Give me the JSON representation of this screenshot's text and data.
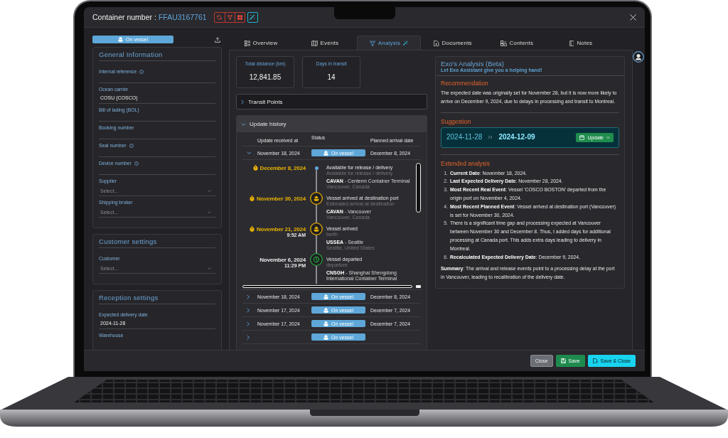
{
  "window": {
    "title": "Container number :",
    "container_number": "FFAU3167761"
  },
  "status_badge": {
    "label": "On vessel"
  },
  "sections": [
    {
      "title": "General Information",
      "fields": [
        {
          "kind": "text",
          "label": "Internal reference",
          "info": true
        },
        {
          "kind": "text",
          "label": "Ocean carrier",
          "info": false,
          "value": "COSU (COSCO)"
        },
        {
          "kind": "text",
          "label": "Bill of lading (BOL)",
          "info": false
        },
        {
          "kind": "text",
          "label": "Booking number",
          "info": false
        },
        {
          "kind": "text",
          "label": "Seal number",
          "info": true
        },
        {
          "kind": "text",
          "label": "Device number",
          "info": true
        },
        {
          "kind": "select",
          "label": "Supplier",
          "info": false,
          "placeholder": "Select..."
        },
        {
          "kind": "select",
          "label": "Shipping broker",
          "info": false,
          "placeholder": "Select..."
        }
      ]
    },
    {
      "title": "Customer settings",
      "fields": [
        {
          "kind": "select",
          "label": "Customer",
          "info": false,
          "placeholder": "Select..."
        }
      ]
    },
    {
      "title": "Reception settings",
      "fields": [
        {
          "kind": "text",
          "label": "Expected delivery date",
          "info": false,
          "value": "2024-11-28"
        },
        {
          "kind": "label",
          "label": "Warehouse",
          "info": false
        }
      ]
    }
  ],
  "tabs": [
    {
      "label": "Overview",
      "selected": false
    },
    {
      "label": "Events",
      "selected": false
    },
    {
      "label": "Analysis",
      "selected": true
    },
    {
      "label": "Documents",
      "selected": false
    },
    {
      "label": "Contents",
      "selected": false
    },
    {
      "label": "Notes",
      "selected": false
    }
  ],
  "stats": [
    {
      "label": "Total distance (km)",
      "value": "12,841.85"
    },
    {
      "label": "Days in transit",
      "value": "14"
    }
  ],
  "transit_points": {
    "title": "Transit Points",
    "expanded": false
  },
  "update_history": {
    "title": "Update history",
    "expanded": true,
    "columns": [
      "Update received at",
      "Status",
      "Planned arrival date"
    ],
    "rows": [
      {
        "expanded": true,
        "received": "November 18, 2024",
        "status": "On vessel",
        "planned": "December 8, 2024",
        "events": [
          {
            "kind": "release",
            "planned": true,
            "date": "December 8, 2024",
            "title": "Available for release / delivery",
            "detail": "Available for release / delivery",
            "location": "**CAVAN** - Centerm Container Terminal",
            "place": "Vancouver, Canada"
          },
          {
            "kind": "arrival",
            "planned": true,
            "date": "November 30, 2024",
            "title": "Vessel arrived at destination port",
            "detail": "Estimated arrival at destination",
            "location": "**CAVAN** - Vancouver",
            "place": "Vancouver, Canada"
          },
          {
            "kind": "arrival",
            "planned": true,
            "date": "November 21, 2024",
            "time": "9:52 AM",
            "title": "Vessel arrived",
            "detail": "berth",
            "location": "**USSEA** - Seattle",
            "place": "Seattle, United States"
          },
          {
            "kind": "departure",
            "planned": false,
            "date": "November 6, 2024",
            "time": "11:29 PM",
            "title": "Vessel departed",
            "detail": "departure",
            "location": "**CNSGH** - Shanghai Shengdong International Container Terminal"
          }
        ]
      },
      {
        "expanded": false,
        "received": "November 18, 2024",
        "status": "On vessel",
        "planned": "December 8, 2024"
      },
      {
        "expanded": false,
        "received": "November 17, 2024",
        "status": "On vessel",
        "planned": "December 7, 2024"
      },
      {
        "expanded": false,
        "received": "November 17, 2024",
        "status": "On vessel",
        "planned": "December 7, 2024"
      },
      {
        "expanded": false,
        "status": "On vessel"
      }
    ]
  },
  "analysis": {
    "title": "Exo's Analysis (Beta)",
    "subtitle": "Let Exo Assistant give you a helping hand!",
    "recommendation": {
      "heading": "Recommendation",
      "text": "The expected date was originally set for November 28, but it is now more likely to arrive on December 9, 2024, due to delays in processing and transit to Montreal."
    },
    "suggestion": {
      "heading": "Suggestion",
      "from": "2024-11-28",
      "to": "2024-12-09",
      "button": "Update"
    },
    "extended": {
      "heading": "Extended analysis",
      "items": [
        {
          "number": "1.",
          "text": "**Current Date**: November 18, 2024."
        },
        {
          "number": "2.",
          "text": "**Last Expected Delivery Date**: November 28, 2024."
        },
        {
          "number": "3.",
          "text": "**Most Recent Real Event**: Vessel 'COSCO BOSTON' departed from the origin port on November 4, 2024."
        },
        {
          "number": "4.",
          "text": "**Most Recent Planned Event**: Vessel arrived at destination port (Vancouver) is set for November 30, 2024."
        },
        {
          "number": "5.",
          "text": "There is a significant time gap and processing expected at Vancouver between November 30 and December 8. Thus, I added days for additional processing at Canada port. This adds extra days leading to delivery in Montreal."
        },
        {
          "number": "6.",
          "text": "**Recalculated Expected Delivery Date**: December 9, 2024."
        }
      ],
      "summary": "**Summary**: The arrival and release events point to a processing delay at the port in Vancouver, leading to recalibration of the delivery date."
    }
  },
  "footer_buttons": [
    {
      "kind": "secondary",
      "label": "Close"
    },
    {
      "kind": "success",
      "label": "Save"
    },
    {
      "kind": "primary",
      "label": "Save & Close"
    }
  ]
}
